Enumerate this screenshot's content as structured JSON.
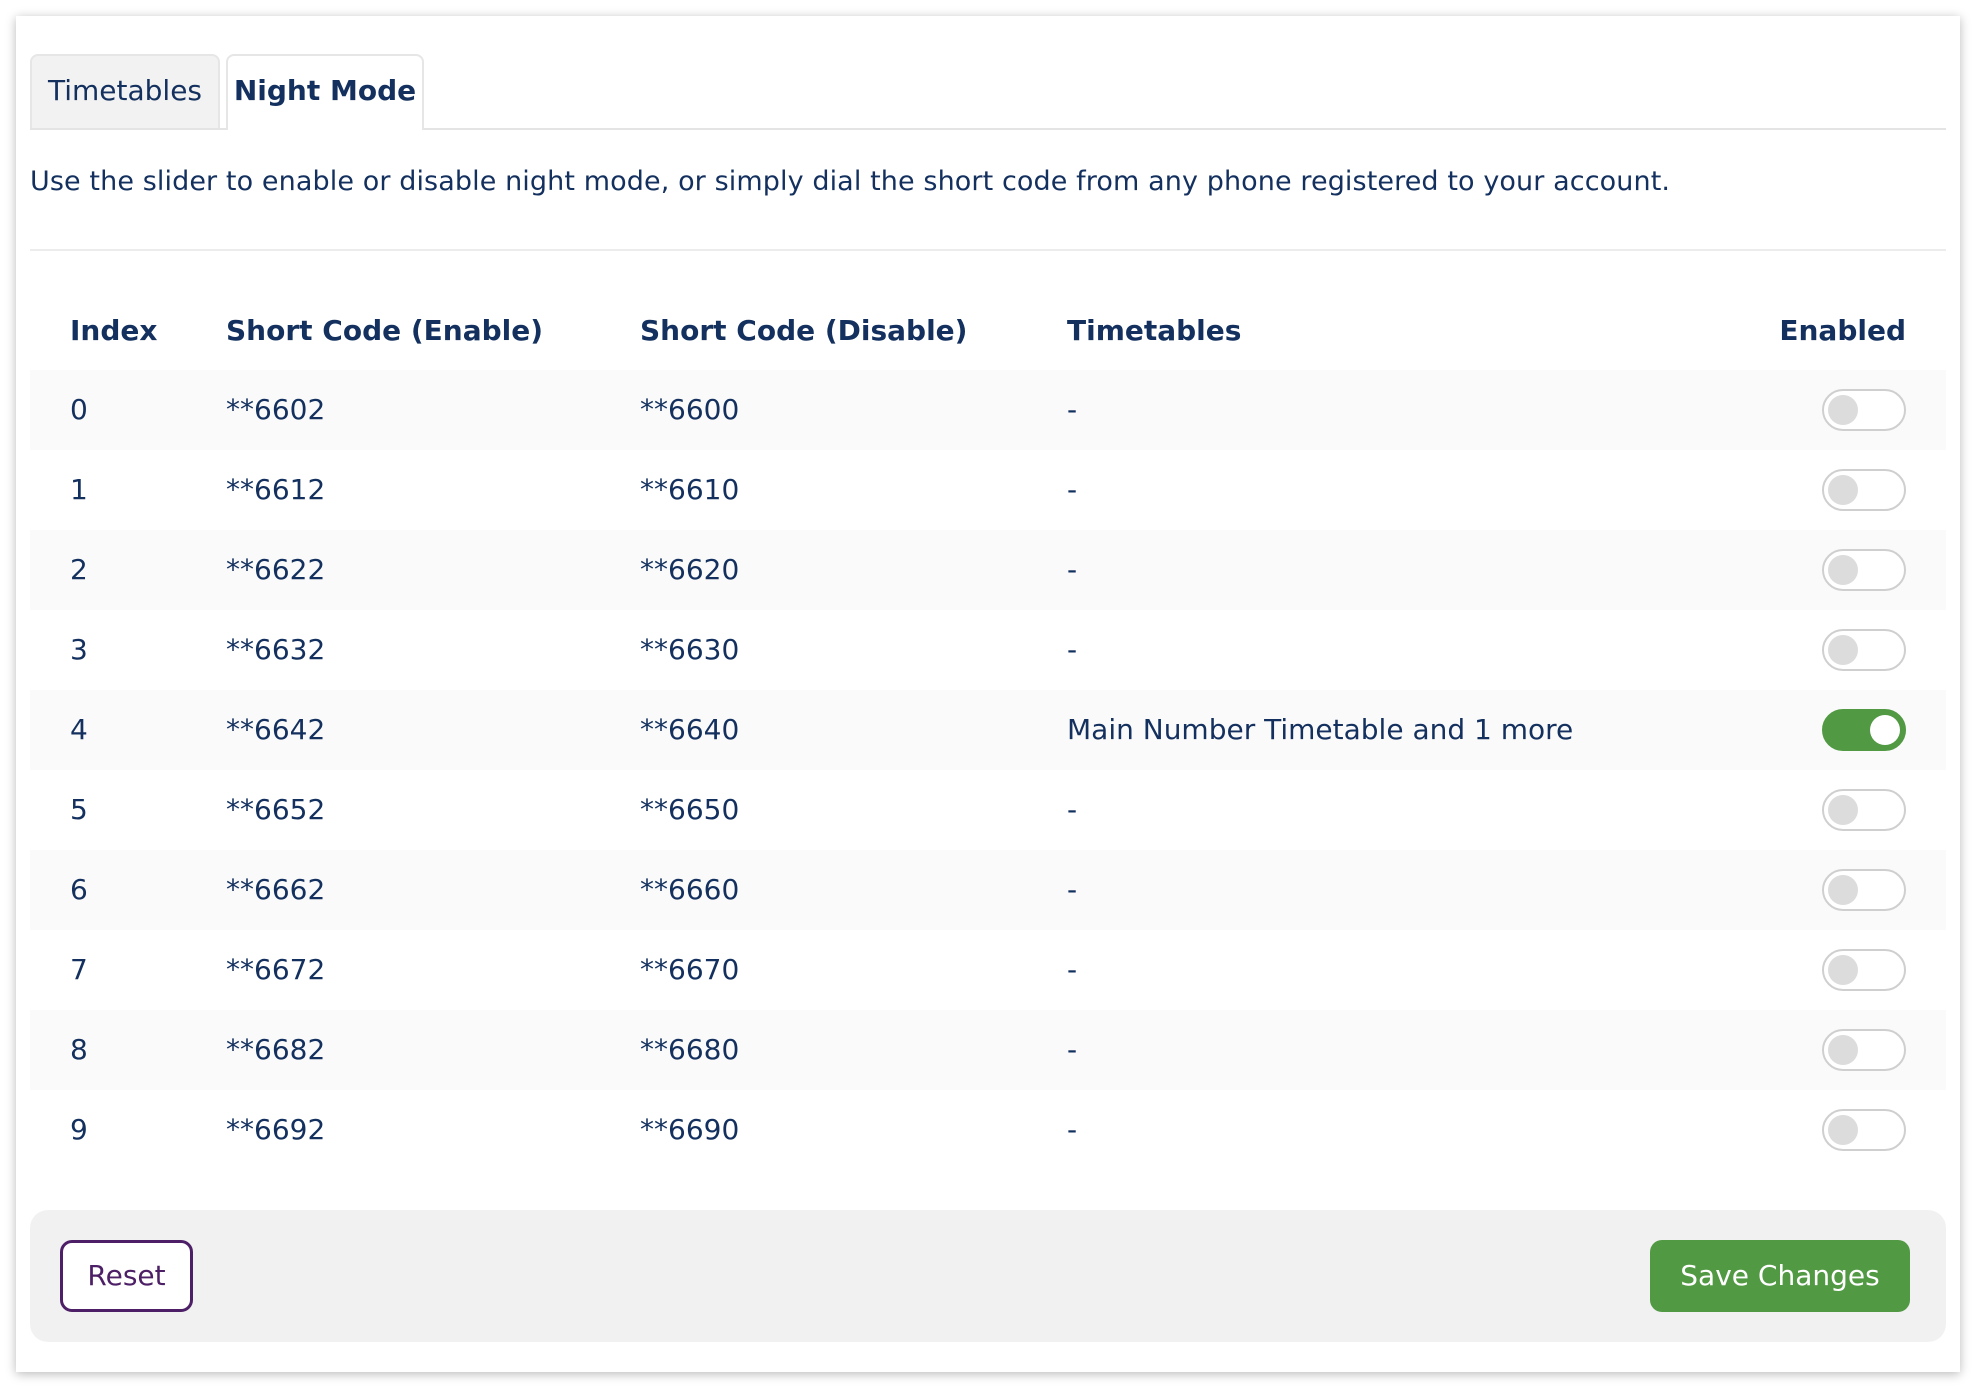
{
  "tabs": [
    {
      "label": "Timetables",
      "active": false
    },
    {
      "label": "Night Mode",
      "active": true
    }
  ],
  "description": "Use the slider to enable or disable night mode, or simply dial the short code from any phone registered to your account.",
  "table": {
    "columns": [
      "Index",
      "Short Code (Enable)",
      "Short Code (Disable)",
      "Timetables",
      "Enabled"
    ],
    "rows": [
      {
        "index": "0",
        "enable_code": "**6602",
        "disable_code": "**6600",
        "timetables": "-",
        "enabled": false
      },
      {
        "index": "1",
        "enable_code": "**6612",
        "disable_code": "**6610",
        "timetables": "-",
        "enabled": false
      },
      {
        "index": "2",
        "enable_code": "**6622",
        "disable_code": "**6620",
        "timetables": "-",
        "enabled": false
      },
      {
        "index": "3",
        "enable_code": "**6632",
        "disable_code": "**6630",
        "timetables": "-",
        "enabled": false
      },
      {
        "index": "4",
        "enable_code": "**6642",
        "disable_code": "**6640",
        "timetables": "Main Number Timetable and 1 more",
        "enabled": true
      },
      {
        "index": "5",
        "enable_code": "**6652",
        "disable_code": "**6650",
        "timetables": "-",
        "enabled": false
      },
      {
        "index": "6",
        "enable_code": "**6662",
        "disable_code": "**6660",
        "timetables": "-",
        "enabled": false
      },
      {
        "index": "7",
        "enable_code": "**6672",
        "disable_code": "**6670",
        "timetables": "-",
        "enabled": false
      },
      {
        "index": "8",
        "enable_code": "**6682",
        "disable_code": "**6680",
        "timetables": "-",
        "enabled": false
      },
      {
        "index": "9",
        "enable_code": "**6692",
        "disable_code": "**6690",
        "timetables": "-",
        "enabled": false
      }
    ]
  },
  "footer": {
    "reset_label": "Reset",
    "save_label": "Save Changes"
  },
  "colors": {
    "text": "#13305e",
    "accent_green": "#529944",
    "reset_purple": "#4d1f66"
  }
}
